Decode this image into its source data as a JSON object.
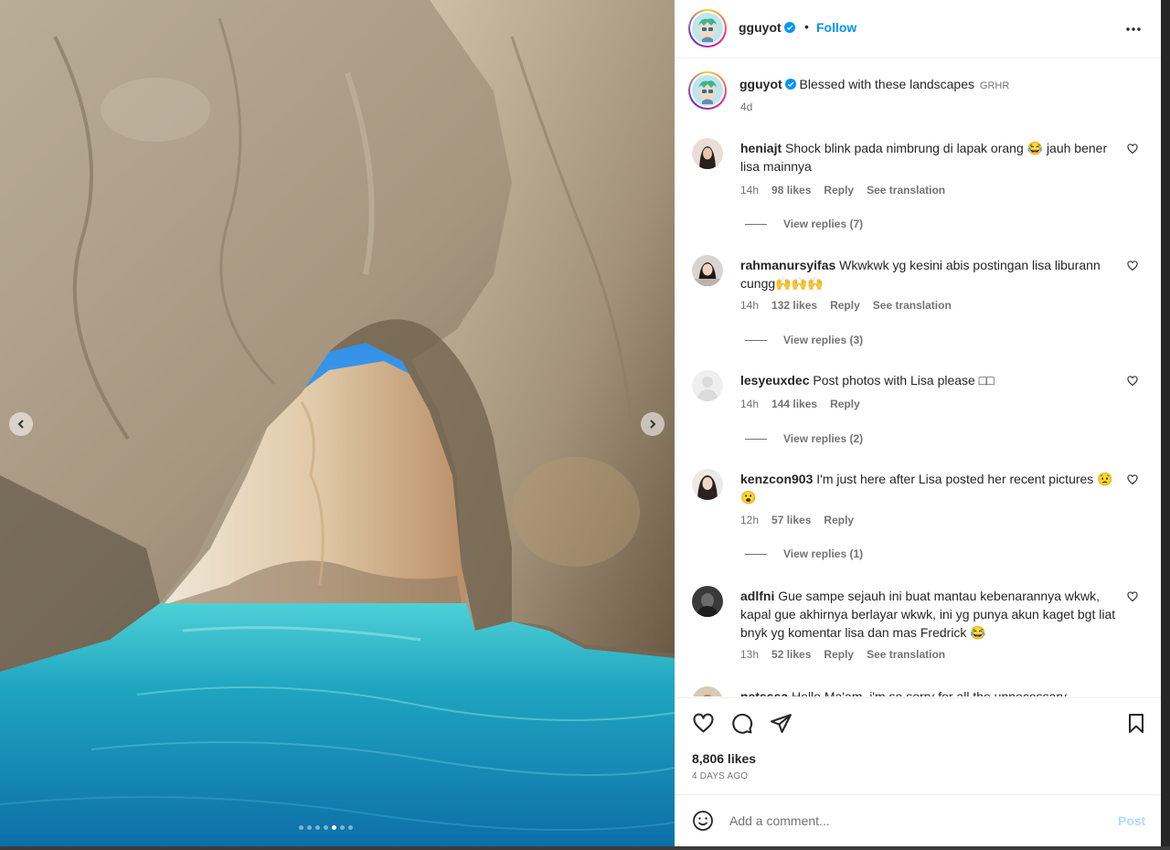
{
  "post": {
    "username": "gguyot",
    "separator": "•",
    "follow_label": "Follow",
    "more_icon": "more-horizontal-icon",
    "caption_text": "Blessed with these landscapes",
    "caption_tag": "GRHR",
    "caption_time": "4d",
    "likes": "8,806 likes",
    "posted_ago": "4 DAYS AGO"
  },
  "carousel": {
    "slides": 7,
    "active_index": 4
  },
  "comments": [
    {
      "username": "heniajt",
      "text": "Shock blink pada nimbrung di lapak orang 😂 jauh bener lisa mainnya",
      "time": "14h",
      "likes": "98 likes",
      "reply_label": "Reply",
      "translate_label": "See translation",
      "view_replies": "View replies (7)"
    },
    {
      "username": "rahmanursyifas",
      "text": "Wkwkwk yg kesini abis postingan lisa liburann cungg🙌🙌🙌",
      "time": "14h",
      "likes": "132 likes",
      "reply_label": "Reply",
      "translate_label": "See translation",
      "view_replies": "View replies (3)"
    },
    {
      "username": "lesyeuxdec",
      "text": "Post photos with Lisa please □□",
      "time": "14h",
      "likes": "144 likes",
      "reply_label": "Reply",
      "view_replies": "View replies (2)"
    },
    {
      "username": "kenzcon903",
      "text": "I'm just here after Lisa posted her recent pictures 😟😮",
      "time": "12h",
      "likes": "57 likes",
      "reply_label": "Reply",
      "view_replies": "View replies (1)"
    },
    {
      "username": "adlfni",
      "text": "Gue sampe sejauh ini buat mantau kebenarannya wkwk, kapal gue akhirnya berlayar wkwk, ini yg punya akun kaget bgt liat bnyk yg komentar lisa dan mas Fredrick 😂",
      "time": "13h",
      "likes": "52 likes",
      "reply_label": "Reply",
      "translate_label": "See translation"
    },
    {
      "username": "netsssa",
      "text": "Hello Ma'am, i'm so sorry for all the unnecessary"
    }
  ],
  "composer": {
    "placeholder": "Add a comment...",
    "post_label": "Post"
  },
  "colors": {
    "link_blue": "#0095f6",
    "post_disabled": "#b3dbff",
    "muted_text": "#737373",
    "sea": "#1fa5c0"
  }
}
